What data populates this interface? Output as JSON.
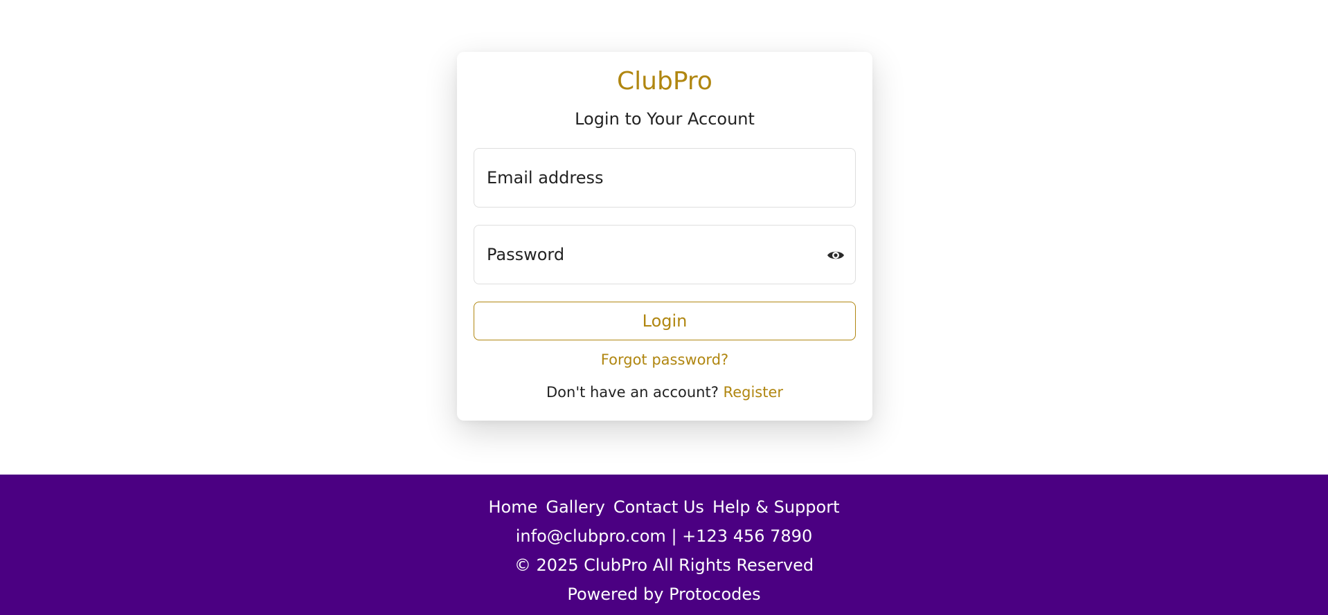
{
  "card": {
    "brand": "ClubPro",
    "subtitle": "Login to Your Account",
    "email_placeholder": "Email address",
    "password_placeholder": "Password",
    "login_label": "Login",
    "forgot_label": "Forgot password?",
    "register_prompt": "Don't have an account?",
    "register_label": "Register"
  },
  "footer": {
    "nav": [
      "Home",
      "Gallery",
      "Contact Us",
      "Help & Support"
    ],
    "contact": "info@clubpro.com | +123 456 7890",
    "copyright": "© 2025 ClubPro All Rights Reserved",
    "powered": "Powered by Protocodes"
  },
  "icons": {
    "password_toggle": "eye-icon"
  },
  "colors": {
    "accent": "#b08610",
    "footer_bg": "#4b0082",
    "text": "#222222"
  }
}
